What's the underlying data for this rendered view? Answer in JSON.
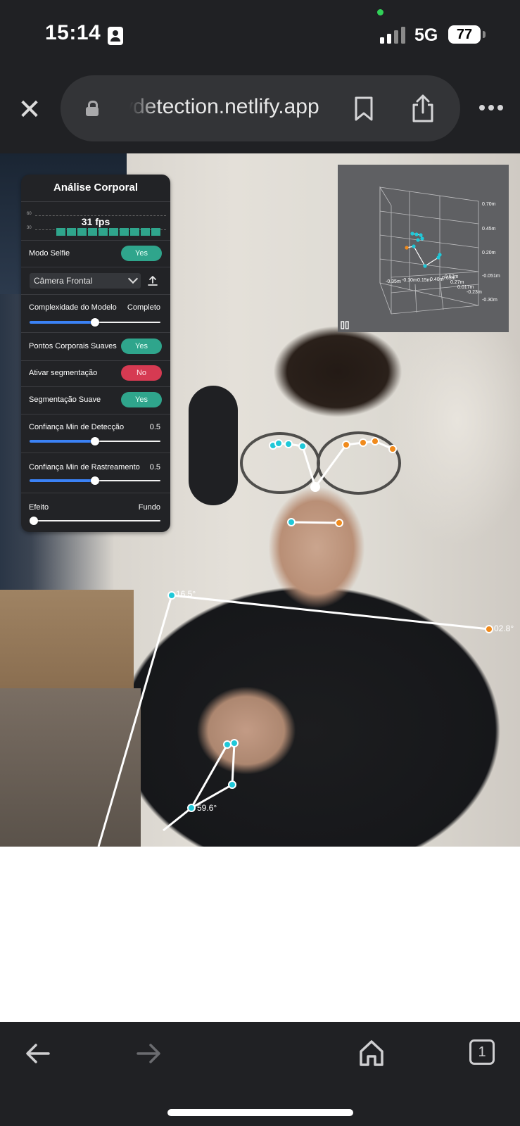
{
  "status_bar": {
    "time": "15:14",
    "network": "5G",
    "battery": "77",
    "icons": [
      "contact-card-icon",
      "signal-icon",
      "battery-icon"
    ]
  },
  "browser": {
    "url": "ydetection.netlify.app",
    "icons": [
      "close-icon",
      "lock-icon",
      "bookmark-icon",
      "share-icon",
      "more-icon"
    ]
  },
  "panel": {
    "title": "Análise Corporal",
    "fps": {
      "label": "31 fps",
      "axis_top": "60",
      "axis_bottom": "30",
      "history": [
        22,
        23,
        22,
        23,
        22,
        23,
        22,
        23,
        23,
        22
      ]
    },
    "selfie": {
      "label": "Modo Selfie",
      "value": "Yes",
      "on": true
    },
    "camera": {
      "selected": "Câmera Frontal"
    },
    "complexity": {
      "label": "Complexidade do Modelo",
      "value": "Completo",
      "level": 0.5
    },
    "smooth_landmarks": {
      "label": "Pontos Corporais Suaves",
      "value": "Yes",
      "on": true
    },
    "segmentation": {
      "label": "Ativar segmentação",
      "value": "No",
      "on": false
    },
    "smooth_segmentation": {
      "label": "Segmentação Suave",
      "value": "Yes",
      "on": true
    },
    "min_detection": {
      "label": "Confiança Min de Detecção",
      "value": "0.5",
      "level": 0.5
    },
    "min_tracking": {
      "label": "Confiança Min de Rastreamento",
      "value": "0.5",
      "level": 0.5
    },
    "effect": {
      "label": "Efeito",
      "value": "Fundo",
      "level": 0.0
    }
  },
  "landmark_grid": {
    "y_ticks": [
      "0.70m",
      "0.45m",
      "0.20m",
      "-0.051m",
      "-0.30m"
    ],
    "x_ticks": [
      "-0.35m",
      "-0.10m",
      "0.15m",
      "0.40m",
      "0.65m"
    ],
    "z_ticks": [
      "0.52m",
      "0.27m",
      "0.017m",
      "-0.23m"
    ]
  },
  "overlay": {
    "angles": [
      "16.5°",
      "02.8°",
      "59.6°"
    ],
    "colors": {
      "left": "#1fc8d8",
      "right": "#f08a1c",
      "line": "#ffffff"
    }
  },
  "toolbar": {
    "tab_count": "1",
    "icons": [
      "back-arrow-icon",
      "forward-arrow-icon",
      "home-icon",
      "tabs-icon"
    ]
  }
}
